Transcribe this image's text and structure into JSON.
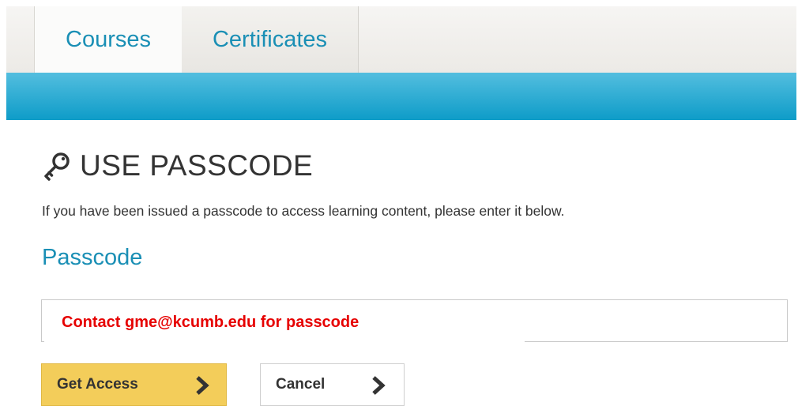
{
  "nav": {
    "tabs": [
      {
        "label": "Courses",
        "active": true
      },
      {
        "label": "Certificates",
        "active": false
      }
    ]
  },
  "colors": {
    "accent": "#1a8fb5",
    "banner": "#0e9cc8",
    "primary_button": "#f3cd5a",
    "note_text": "#e60000"
  },
  "heading": {
    "icon": "key-icon",
    "title": "USE PASSCODE"
  },
  "intro_text": "If you have been issued a passcode to access learning content, please enter it below.",
  "passcode": {
    "label": "Passcode",
    "value": "",
    "note": "Contact gme@kcumb.edu for passcode"
  },
  "buttons": {
    "get_access": "Get Access",
    "cancel": "Cancel"
  }
}
